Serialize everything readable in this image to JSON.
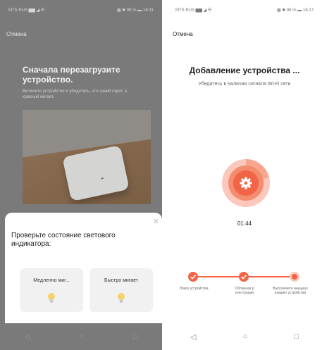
{
  "left": {
    "status": {
      "left": "MTS RUS ▆▆ ◢ ☰",
      "right": "▦ ✱ 85 % ▬ 16:31"
    },
    "cancel": "Отмена",
    "heading": "Сначала перезагрузите устройство.",
    "subtext": "Включите устройство и убедитесь, что синий горит, а красный мигает.",
    "sheet": {
      "close": "✕",
      "prompt": "Проверьте состояние светового индикатора:",
      "options": [
        {
          "label": "Медленно миг..."
        },
        {
          "label": "Быстро мигает"
        }
      ]
    },
    "nav": [
      "◁",
      "○",
      "□"
    ]
  },
  "right": {
    "status": {
      "left": "MTS RUS ▆▆ ◢ ☰",
      "right": "▦ ✱ 86 % ▬ 16:17"
    },
    "cancel": "Отмена",
    "title": "Добавление устройства ...",
    "subtitle": "Убедитесь в наличии сигнала Wi-Fi сети",
    "timer": "01:44",
    "steps": [
      {
        "label": "Поиск устройства"
      },
      {
        "label": "Облачная р егистрация"
      },
      {
        "label": "Выполняете инициал изацию устройства"
      }
    ],
    "nav": [
      "◁",
      "○",
      "□"
    ]
  },
  "colors": {
    "accent": "#f26446",
    "accent_light": "#f9b3a2",
    "sheet": "#ffffff",
    "dim": "#7a7a7a"
  },
  "icons": [
    "gear-icon",
    "check-icon",
    "close-icon",
    "bulb-icon",
    "back-icon",
    "home-icon",
    "recents-icon"
  ]
}
